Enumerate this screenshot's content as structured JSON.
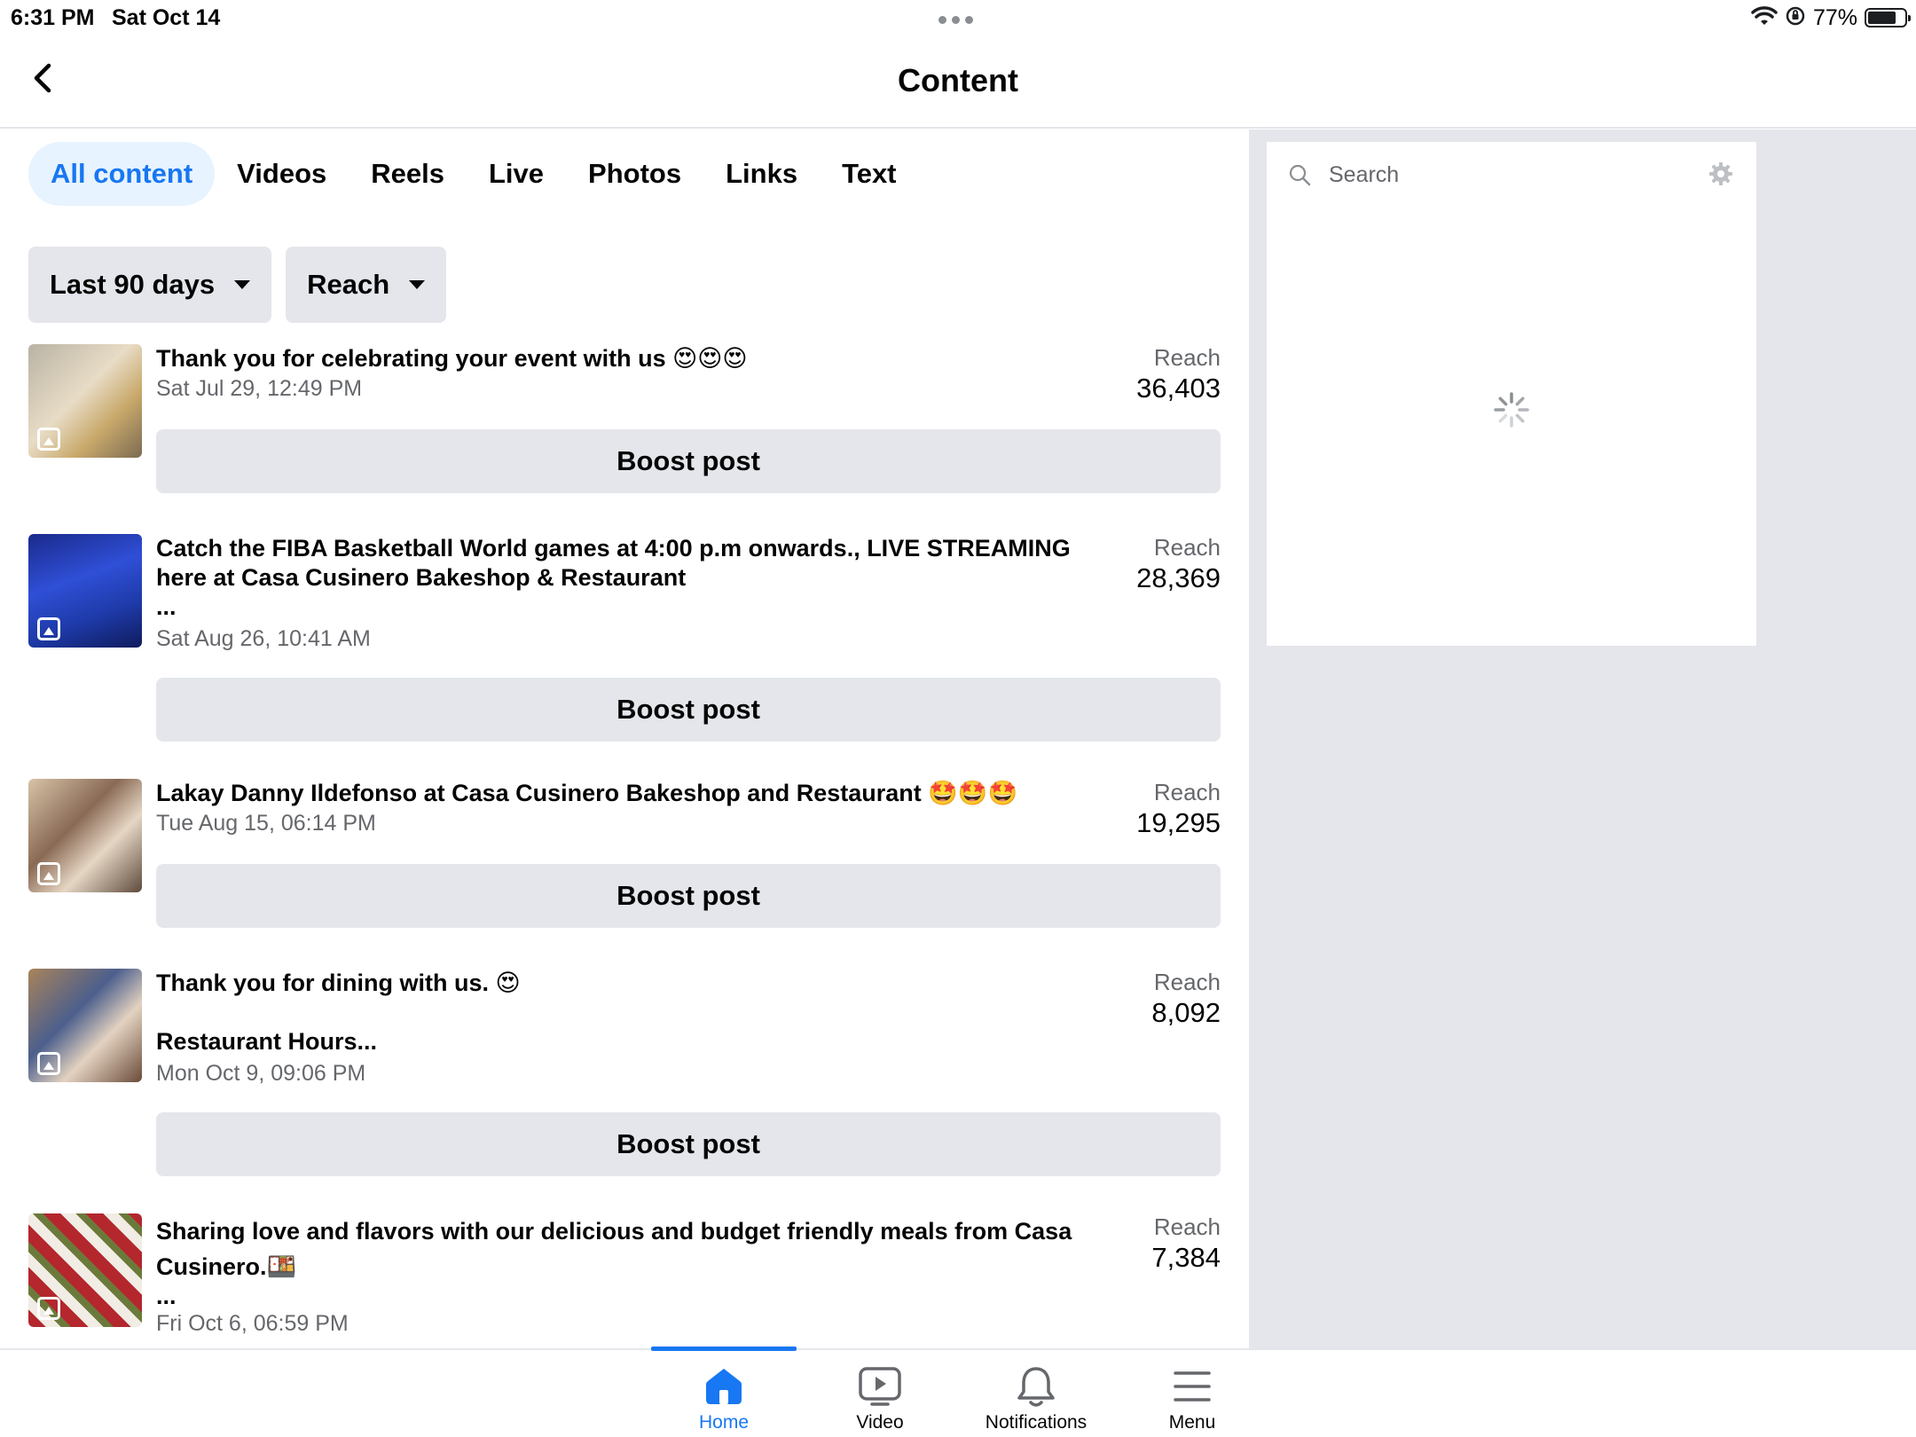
{
  "status_bar": {
    "time": "6:31 PM",
    "date": "Sat Oct 14",
    "battery": "77%",
    "battery_level": 0.77
  },
  "header": {
    "title": "Content"
  },
  "tabs": [
    {
      "label": "All content",
      "active": true
    },
    {
      "label": "Videos"
    },
    {
      "label": "Reels"
    },
    {
      "label": "Live"
    },
    {
      "label": "Photos"
    },
    {
      "label": "Links"
    },
    {
      "label": "Text"
    }
  ],
  "filters": {
    "date_range": "Last 90 days",
    "metric": "Reach"
  },
  "posts": [
    {
      "lines": [
        "Thank you for celebrating your event with us 😍😍😍"
      ],
      "date": "Sat Jul 29, 12:49 PM",
      "reach_label": "Reach",
      "reach": "36,403",
      "boost_label": "Boost post"
    },
    {
      "lines": [
        "Catch the FIBA Basketball World games  at 4:00 p.m onwards., LIVE STREAMING",
        "here at Casa Cusinero Bakeshop & Restaurant",
        "..."
      ],
      "date": "Sat Aug 26, 10:41 AM",
      "reach_label": "Reach",
      "reach": "28,369",
      "boost_label": "Boost post"
    },
    {
      "lines": [
        "Lakay Danny Ildefonso at Casa Cusinero Bakeshop and Restaurant 🤩🤩🤩"
      ],
      "date": "Tue Aug 15, 06:14 PM",
      "reach_label": "Reach",
      "reach": "19,295",
      "boost_label": "Boost post"
    },
    {
      "lines": [
        "Thank you for dining with us. 😍",
        "",
        "Restaurant Hours..."
      ],
      "date": "Mon Oct 9, 09:06 PM",
      "reach_label": "Reach",
      "reach": "8,092",
      "boost_label": "Boost post"
    },
    {
      "lines": [
        "Sharing love and flavors with our  delicious and budget friendly meals from Casa",
        "Cusinero.🍱",
        "..."
      ],
      "date": "Fri Oct 6, 06:59 PM",
      "reach_label": "Reach",
      "reach": "7,384"
    }
  ],
  "side_panel": {
    "search_placeholder": "Search"
  },
  "bottom_nav": [
    {
      "label": "Home",
      "active": true
    },
    {
      "label": "Video"
    },
    {
      "label": "Notifications"
    },
    {
      "label": "Menu"
    }
  ],
  "colors": {
    "accent": "#1877f2",
    "tab_active_bg": "#e7f3ff",
    "button_bg": "#e4e6eb",
    "secondary_text": "#65676b",
    "panel_bg": "#e4e6eb"
  }
}
